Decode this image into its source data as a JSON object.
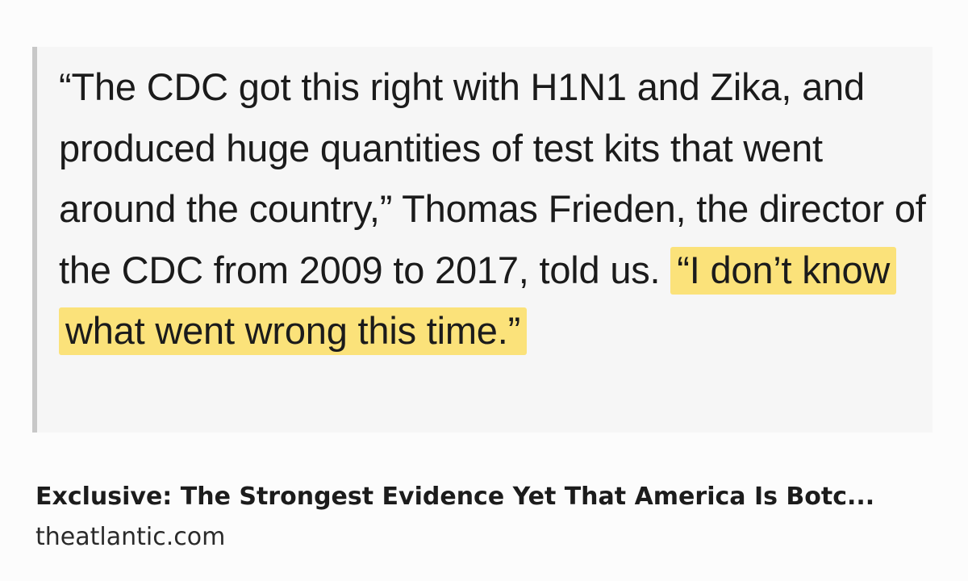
{
  "quote": {
    "text_before": "“The CDC got this right with H1N1 and Zika, and produced huge quantities of test kits that went around the country,” Thomas Frieden, the director of the CDC from 2009 to 2017, told us. ",
    "highlighted": "“I don’t know what went wrong this time.”",
    "highlight_color": "#fbe27a"
  },
  "link": {
    "title": "Exclusive: The Strongest Evidence Yet That America Is Botc...",
    "domain": "theatlantic.com"
  }
}
